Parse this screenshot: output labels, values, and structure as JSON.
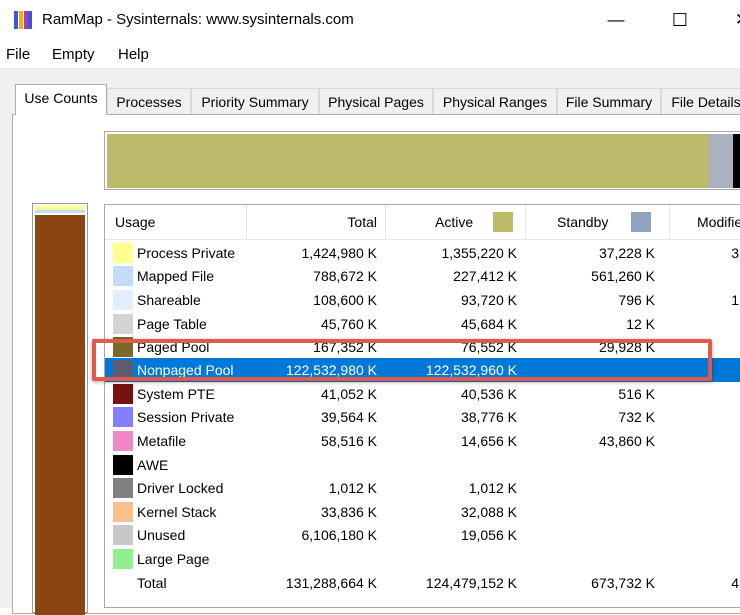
{
  "window": {
    "title": "RamMap - Sysinternals: www.sysinternals.com",
    "minimize": "—",
    "maximize": "☐",
    "close": "✕"
  },
  "menu": [
    "File",
    "Empty",
    "Help"
  ],
  "tabs": [
    "Use Counts",
    "Processes",
    "Priority Summary",
    "Physical Pages",
    "Physical Ranges",
    "File Summary",
    "File Details"
  ],
  "columns": {
    "usage": "Usage",
    "total": "Total",
    "active": "Active",
    "standby": "Standby",
    "modified": "Modifie"
  },
  "colors": {
    "active": "#bdba6a",
    "standby": "#8ea4be",
    "selection": "#0078d7",
    "annotation": "#e05a4a"
  },
  "rows": [
    {
      "usage": "Process Private",
      "color": "#ffff90",
      "total": "1,424,980 K",
      "active": "1,355,220 K",
      "standby": "37,228 K",
      "modified": "3"
    },
    {
      "usage": "Mapped File",
      "color": "#c2dcf6",
      "total": "788,672 K",
      "active": "227,412 K",
      "standby": "561,260 K",
      "modified": ""
    },
    {
      "usage": "Shareable",
      "color": "#e3eefb",
      "total": "108,600 K",
      "active": "93,720 K",
      "standby": "796 K",
      "modified": "1"
    },
    {
      "usage": "Page Table",
      "color": "#d3d3d3",
      "total": "45,760 K",
      "active": "45,684 K",
      "standby": "12 K",
      "modified": ""
    },
    {
      "usage": "Paged Pool",
      "color": "#7a6a2a",
      "total": "167,352 K",
      "active": "76,552 K",
      "standby": "29,928 K",
      "modified": ""
    },
    {
      "usage": "Nonpaged Pool",
      "color": "#5b5b73",
      "total": "122,532,980 K",
      "active": "122,532,960 K",
      "standby": "",
      "modified": "",
      "selected": true
    },
    {
      "usage": "System PTE",
      "color": "#7a1010",
      "total": "41,052 K",
      "active": "40,536 K",
      "standby": "516 K",
      "modified": ""
    },
    {
      "usage": "Session Private",
      "color": "#8080ff",
      "total": "39,564 K",
      "active": "38,776 K",
      "standby": "732 K",
      "modified": ""
    },
    {
      "usage": "Metafile",
      "color": "#ee88c8",
      "total": "58,516 K",
      "active": "14,656 K",
      "standby": "43,860 K",
      "modified": ""
    },
    {
      "usage": "AWE",
      "color": "#000000",
      "total": "",
      "active": "",
      "standby": "",
      "modified": ""
    },
    {
      "usage": "Driver Locked",
      "color": "#808080",
      "total": "1,012 K",
      "active": "1,012 K",
      "standby": "",
      "modified": ""
    },
    {
      "usage": "Kernel Stack",
      "color": "#f8c090",
      "total": "33,836 K",
      "active": "32,088 K",
      "standby": "",
      "modified": ""
    },
    {
      "usage": "Unused",
      "color": "#c8c8c8",
      "total": "6,106,180 K",
      "active": "19,056 K",
      "standby": "",
      "modified": ""
    },
    {
      "usage": "Large Page",
      "color": "#90f090",
      "total": "",
      "active": "",
      "standby": "",
      "modified": ""
    },
    {
      "usage": "Total",
      "color": "",
      "total": "131,288,664 K",
      "active": "124,479,152 K",
      "standby": "673,732 K",
      "modified": "4"
    }
  ]
}
